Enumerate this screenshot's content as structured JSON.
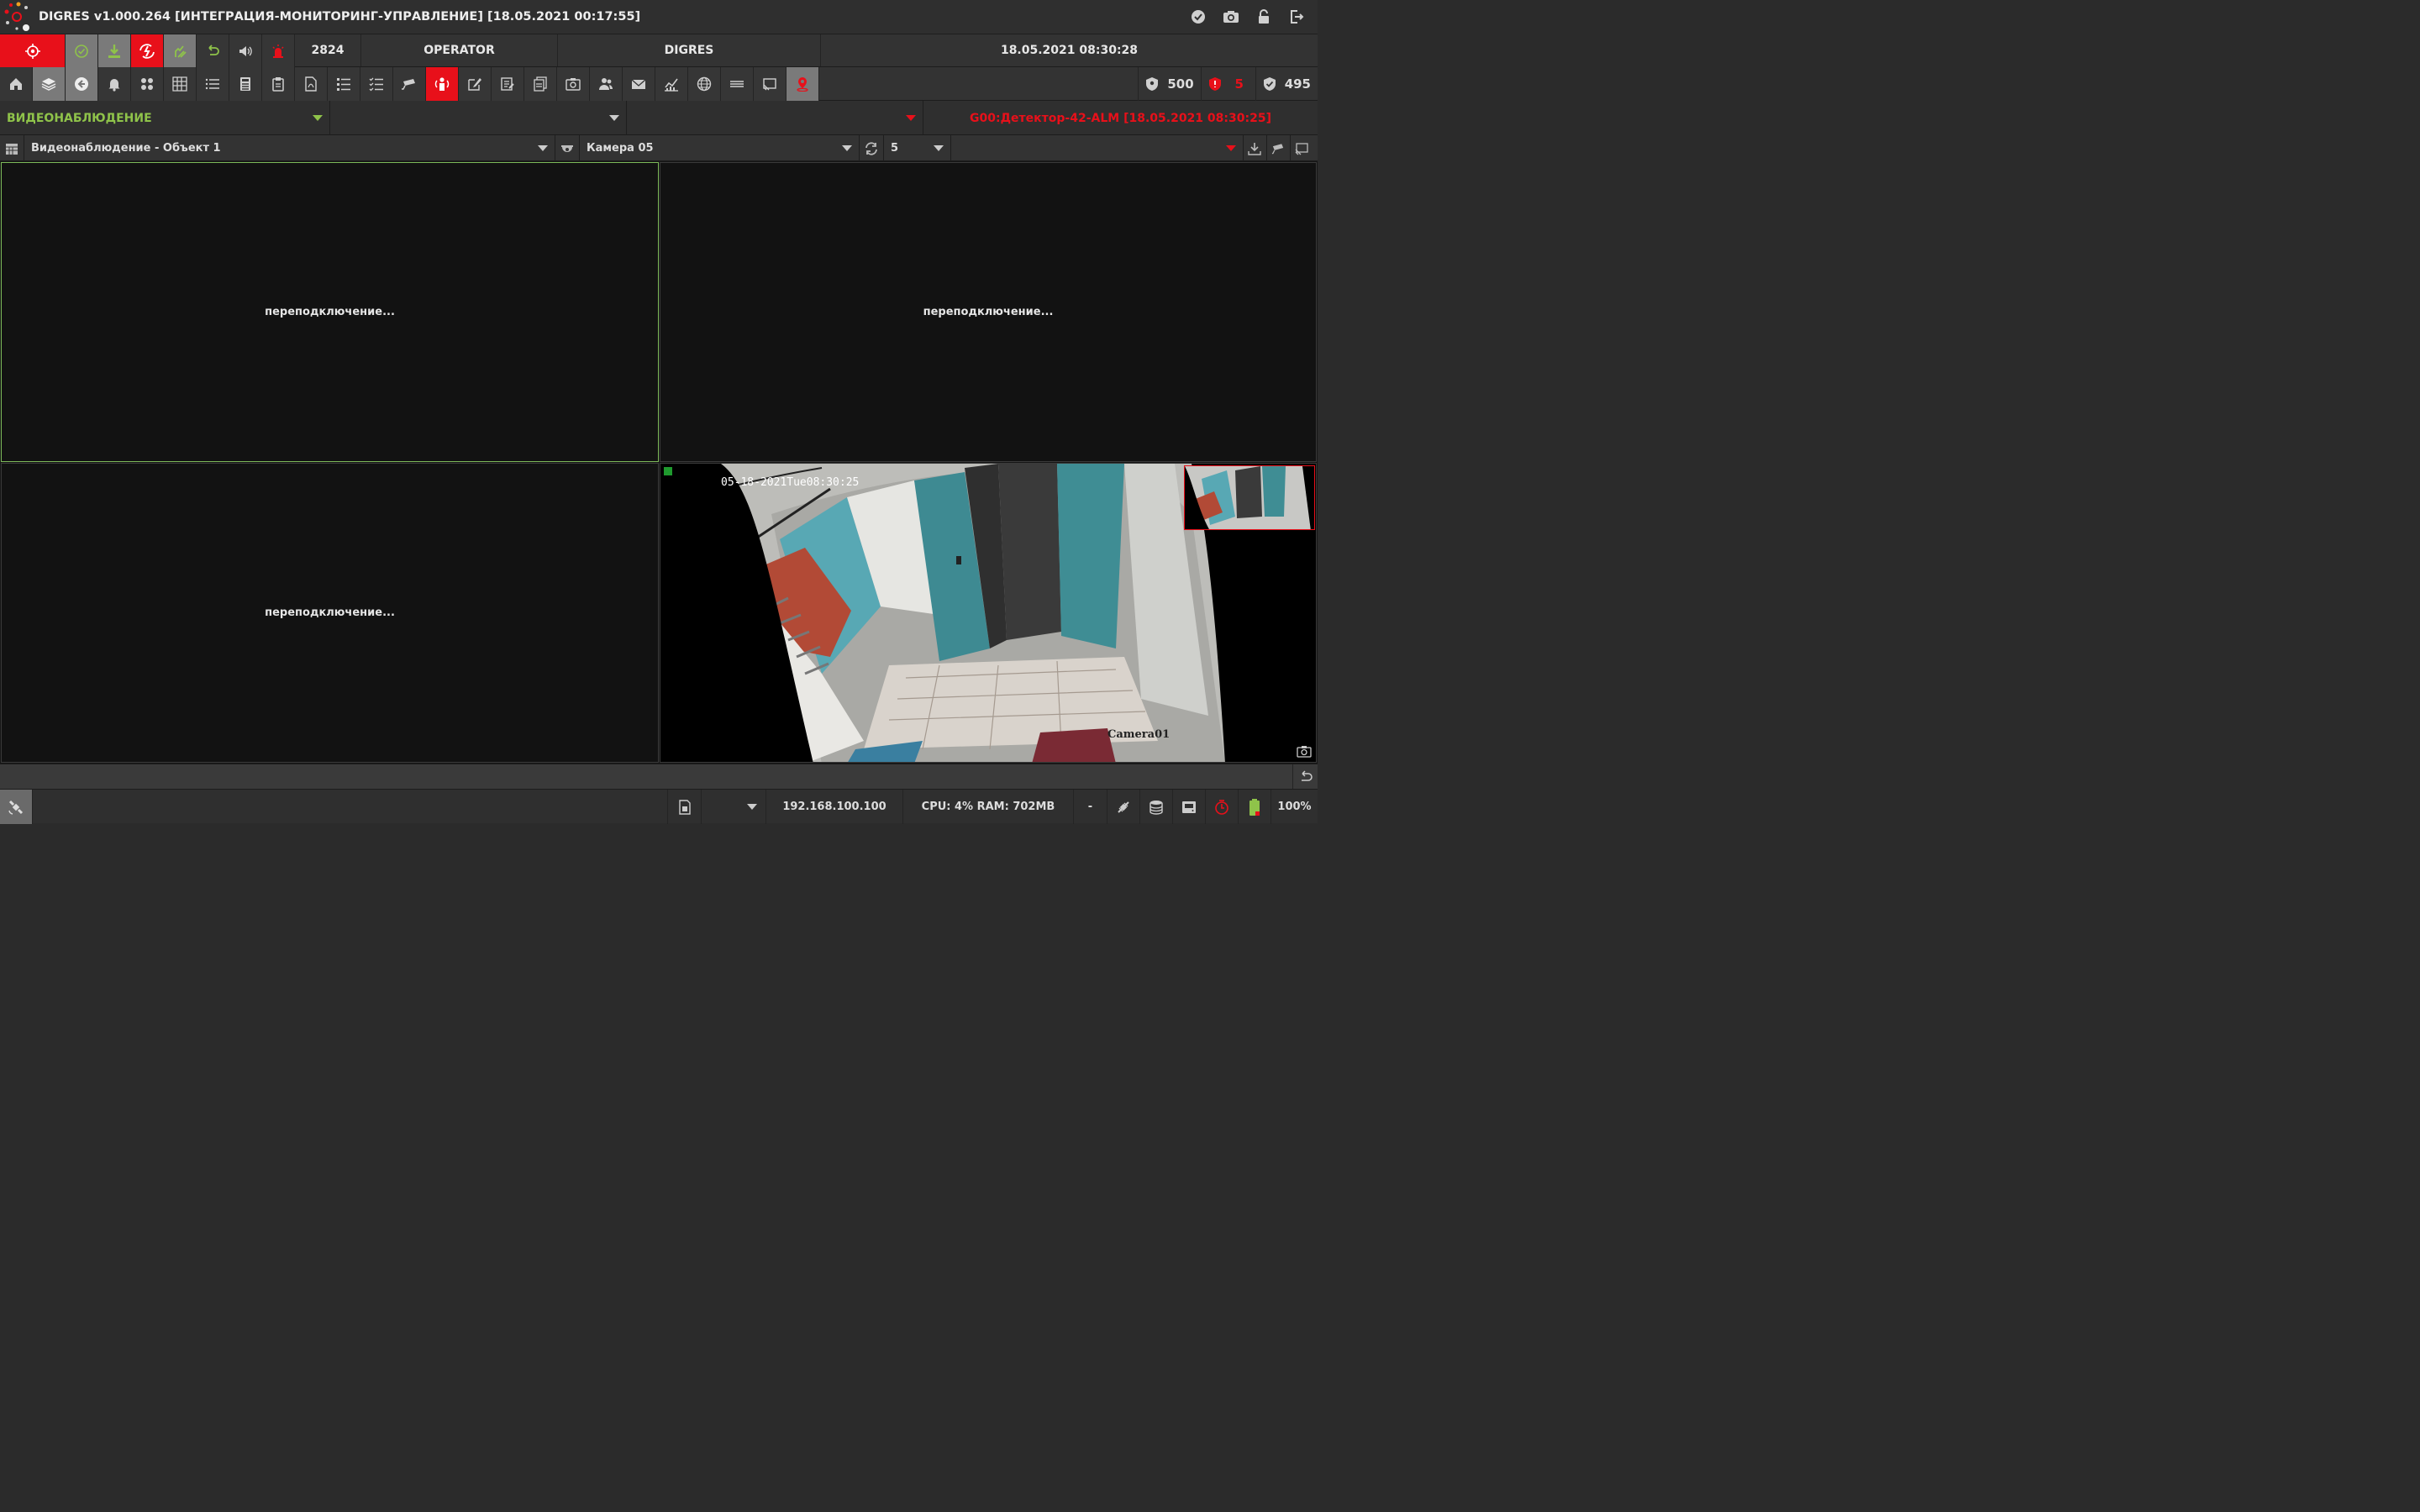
{
  "window": {
    "title": "DIGRES v1.000.264 [ИНТЕГРАЦИЯ-МОНИТОРИНГ-УПРАВЛЕНИЕ] [18.05.2021 00:17:55]",
    "right_icons": [
      "check-circle-icon",
      "camera-icon",
      "lock-icon",
      "logout-icon"
    ]
  },
  "toolbar1": {
    "counter": "2824",
    "user": "OPERATOR",
    "system": "DIGRES",
    "datetime": "18.05.2021 08:30:28"
  },
  "toolbar2": {
    "counters": [
      {
        "icon": "shield-icon",
        "value": "500",
        "color": "#dddddd"
      },
      {
        "icon": "red-shield-icon",
        "value": "5",
        "color": "#e8101a"
      },
      {
        "icon": "check-shield-icon",
        "value": "495",
        "color": "#dddddd"
      }
    ]
  },
  "row3": {
    "module": "ВИДЕОНАБЛЮДЕНИЕ",
    "module_color": "#8fc34a",
    "alarm": "G00:Детектор-42-ALM [18.05.2021 08:30:25]",
    "alarm_color": "#e8101a"
  },
  "row4": {
    "object": "Видеонаблюдение - Объект 1",
    "camera": "Камера 05",
    "cycle": "5"
  },
  "panes": {
    "msg1": "переподключение...",
    "msg2": "переподключение...",
    "msg3": "переподключение...",
    "osd_time": "05-18-2021Tue08:30:25",
    "osd_name": "Camera01"
  },
  "bottom": {
    "ip": "192.168.100.100",
    "resources": "CPU: 4% RAM: 702MB",
    "dash": "-",
    "battery": "100%"
  }
}
